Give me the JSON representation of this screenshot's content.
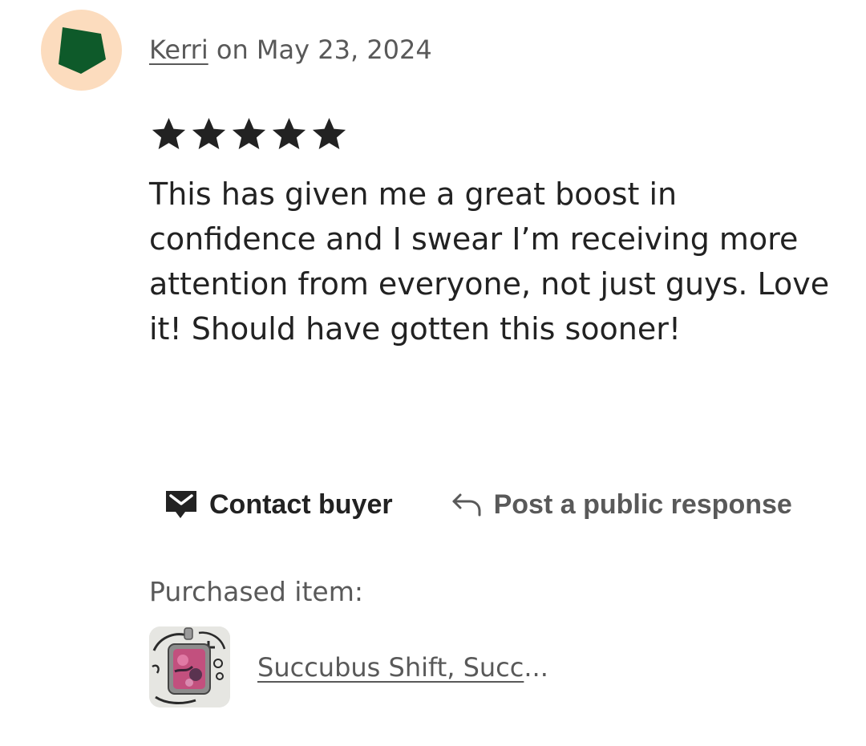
{
  "review": {
    "reviewer_name": "Kerri",
    "date_text": " on May 23, 2024",
    "rating": 5,
    "rating_max": 5,
    "text": "This has given me a great boost in confidence and I swear I’m receiving more attention from everyone, not just guys. Love it! Should have gotten this sooner!"
  },
  "actions": {
    "contact_label": "Contact buyer",
    "public_response_label": "Post a public response"
  },
  "purchased": {
    "label": "Purchased item:",
    "item_title": "Succubus Shift, Succ",
    "ellipsis": "..."
  },
  "colors": {
    "avatar_bg": "#fcdcbe",
    "avatar_shape": "#0e5a2a",
    "text_primary": "#222222",
    "text_secondary": "#595959"
  },
  "icons": {
    "avatar": "green-pentagon-avatar-icon",
    "rating": "star-icon",
    "contact": "envelope-icon",
    "public_response": "reply-arrow-icon",
    "thumbnail": "pendant-product-thumbnail"
  }
}
